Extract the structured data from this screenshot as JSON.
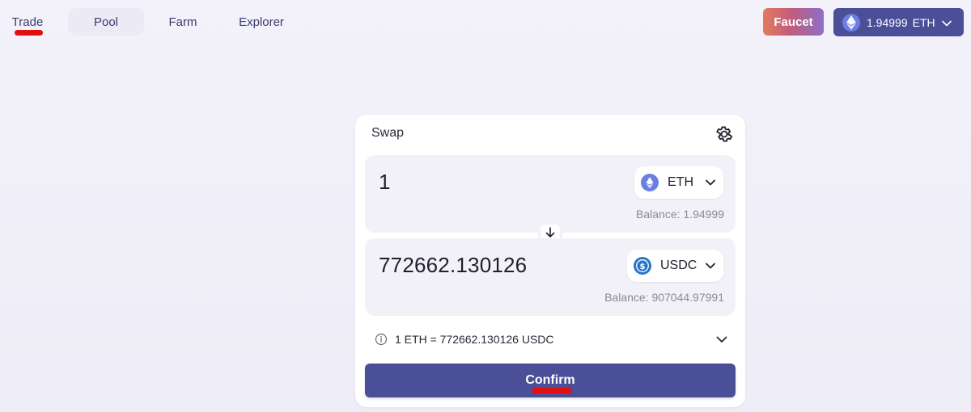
{
  "nav": {
    "items": [
      {
        "label": "Trade"
      },
      {
        "label": "Pool"
      },
      {
        "label": "Farm"
      },
      {
        "label": "Explorer"
      }
    ],
    "faucet_label": "Faucet",
    "wallet": {
      "balance": "1.94999",
      "symbol": "ETH",
      "icon": "eth-icon"
    }
  },
  "swap": {
    "title": "Swap",
    "settings_icon": "gear-icon",
    "from": {
      "amount": "1",
      "token": "ETH",
      "token_icon": "eth-icon",
      "balance": "Balance: 1.94999"
    },
    "to": {
      "amount": "772662.130126",
      "token": "USDC",
      "token_icon": "usdc-icon",
      "balance": "Balance: 907044.97991"
    },
    "switch_icon": "arrow-down-icon",
    "rate": "1 ETH = 772662.130126 USDC",
    "confirm_label": "Confirm"
  },
  "colors": {
    "primary": "#4b4f98",
    "background": "#f1eff8",
    "panel": "#f2f1f7",
    "annotation_red": "#e11010"
  }
}
